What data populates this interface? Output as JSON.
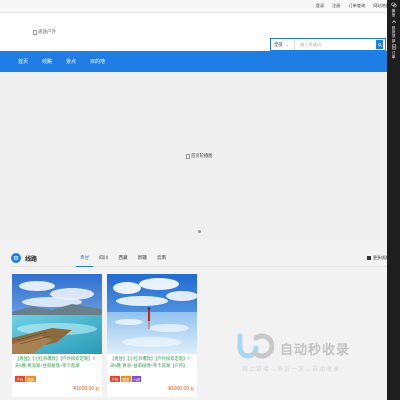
{
  "topbar": {
    "links": [
      "登录",
      "注册",
      "订单查询",
      "网站地图"
    ]
  },
  "header": {
    "logo_alt": "途途户外",
    "search": {
      "category": "全部",
      "placeholder": "输入关键词"
    }
  },
  "nav": {
    "items": [
      "首页",
      "线路",
      "景点",
      "目的地"
    ]
  },
  "banner": {
    "alt": "首页轮播图"
  },
  "section": {
    "title": "线路",
    "tabs": [
      "青甘",
      "四川",
      "西藏",
      "新疆",
      "云南"
    ],
    "active_tab": 0,
    "more_label": "更多线路",
    "accent_color": "#1e7ee6"
  },
  "cards": [
    {
      "title": "【青甘】【小红书爆款】【户外探索定制】7天6晚 青海湖+甘南秘境+茶卡盐湖",
      "tags": [
        {
          "label": "户外",
          "color": "#e8452c"
        },
        {
          "label": "跟团",
          "color": "#f28f1e"
        }
      ],
      "price": "¥1000.00",
      "price_unit": "起"
    },
    {
      "title": "【青甘】【小红书爆款】【户外探索定制】7天6晚 青海+甘南秘境+茶卡盐湖【户外】",
      "tags": [
        {
          "label": "户外",
          "color": "#e8452c"
        },
        {
          "label": "跟团",
          "color": "#f28f1e"
        },
        {
          "label": "小团",
          "color": "#7b4ad6"
        }
      ],
      "price": "¥1000.00",
      "price_unit": "起"
    }
  ],
  "watermark": {
    "main": "自动秒收录",
    "sub": "做上链接→来访一次→自动收录"
  },
  "sidebar": {
    "items": [
      "微信",
      "回到顶部",
      "订单"
    ]
  }
}
